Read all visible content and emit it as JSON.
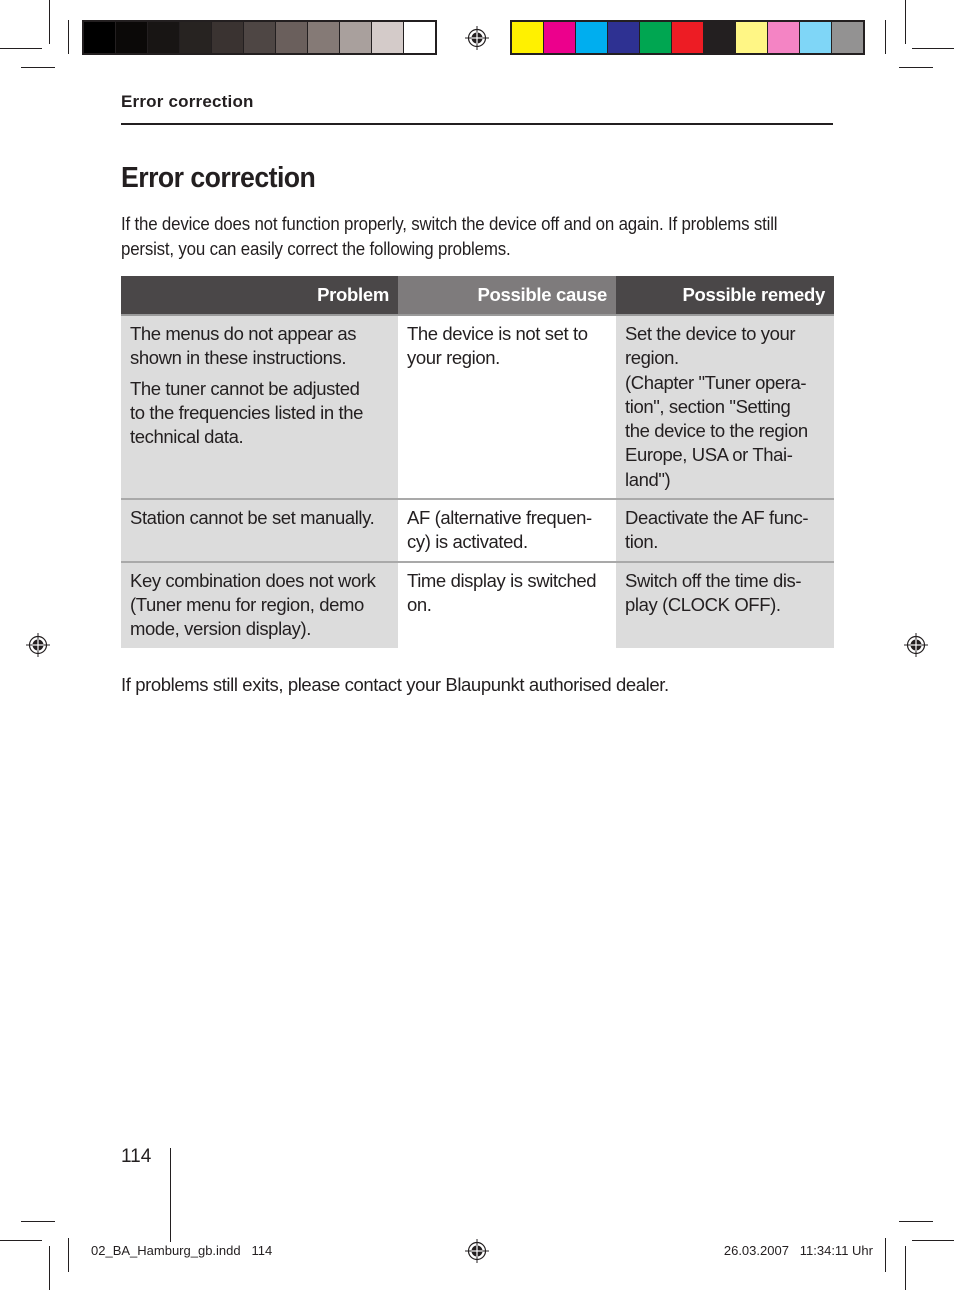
{
  "print_marks": {
    "grayscale_swatches": [
      "#000000",
      "#0b0908",
      "#181514",
      "#272321",
      "#3a3331",
      "#4e4644",
      "#6a5f5c",
      "#857a76",
      "#a9a09d",
      "#d4cbc9",
      "#ffffff"
    ],
    "color_swatches": [
      "#fff100",
      "#ec008c",
      "#00aeef",
      "#2e3192",
      "#00a651",
      "#ed1c24",
      "#231f20",
      "#fff685",
      "#f484c4",
      "#7fd6f7",
      "#939292"
    ]
  },
  "running_head": "Error correction",
  "page_title": "Error correction",
  "intro": "If the device does not function properly, switch the device off and on again. If problems still persist, you can easily correct the following problems.",
  "table": {
    "headers": [
      "Problem",
      "Possible cause",
      "Possible remedy"
    ],
    "rows": [
      {
        "problem": [
          "The menus do not appear as\nshown in these instructions.",
          "The tuner cannot be adjusted\nto the frequencies listed in the\ntechnical data."
        ],
        "cause": "The device is not set to\nyour region.",
        "remedy": "Set the device to your\nregion.\n(Chapter \"Tuner opera-\ntion\", section \"Setting\nthe device to the region\nEurope, USA or Thai-\nland\")"
      },
      {
        "problem": [
          "Station cannot be set manually."
        ],
        "cause": "AF (alternative frequen-\ncy) is activated.",
        "remedy": "Deactivate the AF func-\ntion."
      },
      {
        "problem": [
          "Key combination does not work\n(Tuner menu for region, demo\nmode, version display)."
        ],
        "cause": "Time display is switched\non.",
        "remedy": "Switch off the time dis-\nplay (CLOCK OFF)."
      }
    ]
  },
  "closing": "If problems still exits, please contact your Blaupunkt authorised dealer.",
  "page_number": "114",
  "slug": {
    "file": "02_BA_Hamburg_gb.indd   114",
    "timestamp": "26.03.2007   11:34:11 Uhr"
  }
}
